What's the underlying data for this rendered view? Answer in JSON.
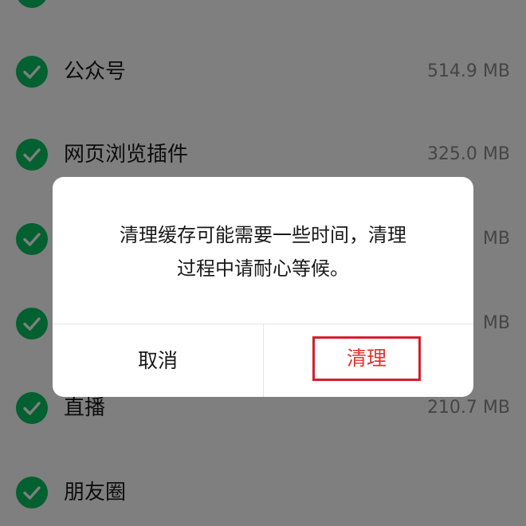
{
  "list": [
    {
      "label": "",
      "size": ""
    },
    {
      "label": "公众号",
      "size": "514.9 MB"
    },
    {
      "label": "网页浏览插件",
      "size": "325.0 MB"
    },
    {
      "label": "",
      "size": "MB"
    },
    {
      "label": "",
      "size": "MB"
    },
    {
      "label": "直播",
      "size": "210.7 MB"
    },
    {
      "label": "朋友圈",
      "size": ""
    }
  ],
  "dialog": {
    "message_line1": "清理缓存可能需要一些时间，清理",
    "message_line2": "过程中请耐心等候。",
    "cancel_label": "取消",
    "confirm_label": "清理"
  },
  "colors": {
    "check_green": "#07c160",
    "confirm_red": "#e5322d",
    "highlight_border": "#d4202b"
  }
}
